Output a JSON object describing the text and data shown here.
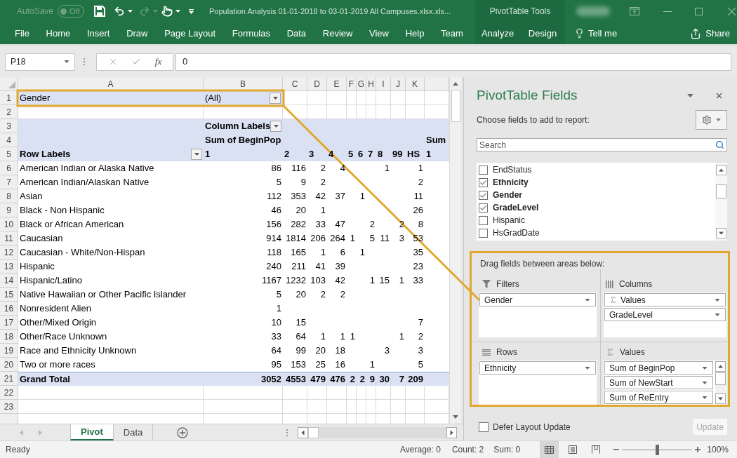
{
  "title_bar": {
    "autosave": {
      "label": "AutoSave",
      "toggle_label": "Off",
      "on": false
    },
    "redo_disabled": true,
    "document_title": "Population Analysis 01-01-2018 to 03-01-2019 All Campuses.xlsx.xls...",
    "context_group": "PivotTable Tools"
  },
  "ribbon": {
    "tabs": [
      {
        "label": "File",
        "contextual": false
      },
      {
        "label": "Home",
        "contextual": false
      },
      {
        "label": "Insert",
        "contextual": false
      },
      {
        "label": "Draw",
        "contextual": false
      },
      {
        "label": "Page Layout",
        "contextual": false
      },
      {
        "label": "Formulas",
        "contextual": false
      },
      {
        "label": "Data",
        "contextual": false
      },
      {
        "label": "Review",
        "contextual": false
      },
      {
        "label": "View",
        "contextual": false
      },
      {
        "label": "Help",
        "contextual": false
      },
      {
        "label": "Team",
        "contextual": false
      },
      {
        "label": "Analyze",
        "contextual": true
      },
      {
        "label": "Design",
        "contextual": true
      }
    ],
    "tell_me": "Tell me",
    "share": "Share"
  },
  "formula_bar": {
    "name_box": "P18",
    "function_button": "fx",
    "formula": "0"
  },
  "sheet": {
    "columns": [
      "A",
      "B",
      "C",
      "D",
      "E",
      "F",
      "G",
      "H",
      "I",
      "J",
      "K"
    ],
    "rows": [
      {
        "number": "1",
        "kind": "filter",
        "cells": [
          "Gender",
          {
            "text": "(All)",
            "filter_button": true
          }
        ]
      },
      {
        "number": "2",
        "kind": "blank"
      },
      {
        "number": "3",
        "kind": "header",
        "cells": [
          null,
          {
            "text": "Column Labels",
            "filter_button": true
          }
        ]
      },
      {
        "number": "4",
        "kind": "header",
        "cells": [
          null,
          "Sum of BeginPop",
          null,
          null,
          null,
          null,
          null,
          null,
          null,
          null,
          null,
          "Sum"
        ]
      },
      {
        "number": "5",
        "kind": "header",
        "cells": [
          {
            "text": "Row Labels",
            "filter_button": true
          },
          "1",
          "2",
          "3",
          "4",
          "5",
          "6",
          "7",
          "8",
          "99",
          "HS",
          "1"
        ]
      },
      {
        "number": "6",
        "kind": "data",
        "cells": [
          "American Indian or Alaska Native",
          "86",
          "116",
          "2",
          "4",
          null,
          null,
          null,
          "1",
          null,
          "1"
        ]
      },
      {
        "number": "7",
        "kind": "data",
        "cells": [
          "American Indian/Alaskan Native",
          "5",
          "9",
          "2",
          null,
          null,
          null,
          null,
          null,
          null,
          "2"
        ]
      },
      {
        "number": "8",
        "kind": "data",
        "cells": [
          "Asian",
          "112",
          "353",
          "42",
          "37",
          null,
          "1",
          null,
          null,
          null,
          "11"
        ]
      },
      {
        "number": "9",
        "kind": "data",
        "cells": [
          "Black - Non Hispanic",
          "46",
          "20",
          "1",
          null,
          null,
          null,
          null,
          null,
          null,
          "26"
        ]
      },
      {
        "number": "10",
        "kind": "data",
        "cells": [
          "Black or African American",
          "156",
          "282",
          "33",
          "47",
          null,
          null,
          "2",
          null,
          "2",
          "8"
        ]
      },
      {
        "number": "11",
        "kind": "data",
        "cells": [
          "Caucasian",
          "914",
          "1814",
          "206",
          "264",
          "1",
          null,
          "5",
          "11",
          "3",
          "53"
        ]
      },
      {
        "number": "12",
        "kind": "data",
        "cells": [
          "Caucasian - White/Non-Hispan",
          "118",
          "165",
          "1",
          "6",
          null,
          "1",
          null,
          null,
          null,
          "35"
        ]
      },
      {
        "number": "13",
        "kind": "data",
        "cells": [
          "Hispanic",
          "240",
          "211",
          "41",
          "39",
          null,
          null,
          null,
          null,
          null,
          "23"
        ]
      },
      {
        "number": "14",
        "kind": "data",
        "cells": [
          "Hispanic/Latino",
          "1167",
          "1232",
          "103",
          "42",
          null,
          null,
          "1",
          "15",
          "1",
          "33"
        ]
      },
      {
        "number": "15",
        "kind": "data",
        "cells": [
          "Native Hawaiian or Other Pacific Islander",
          "5",
          "20",
          "2",
          "2"
        ]
      },
      {
        "number": "16",
        "kind": "data",
        "cells": [
          "Nonresident Alien",
          "1"
        ]
      },
      {
        "number": "17",
        "kind": "data",
        "cells": [
          "Other/Mixed Origin",
          "10",
          "15",
          null,
          null,
          null,
          null,
          null,
          null,
          null,
          "7"
        ]
      },
      {
        "number": "18",
        "kind": "data",
        "cells": [
          "Other/Race Unknown",
          "33",
          "64",
          "1",
          "1",
          "1",
          null,
          null,
          null,
          "1",
          "2"
        ]
      },
      {
        "number": "19",
        "kind": "data",
        "cells": [
          "Race and Ethnicity Unknown",
          "64",
          "99",
          "20",
          "18",
          null,
          null,
          null,
          "3",
          null,
          "3"
        ]
      },
      {
        "number": "20",
        "kind": "data",
        "cells": [
          "Two or more races",
          "95",
          "153",
          "25",
          "16",
          null,
          null,
          "1",
          null,
          null,
          "5"
        ]
      },
      {
        "number": "21",
        "kind": "total",
        "cells": [
          "Grand Total",
          "3052",
          "4553",
          "479",
          "476",
          "2",
          "2",
          "9",
          "30",
          "7",
          "209"
        ]
      },
      {
        "number": "22",
        "kind": "empty"
      },
      {
        "number": "23",
        "kind": "empty"
      }
    ]
  },
  "sheet_tabs": [
    {
      "label": "Pivot",
      "selected": true
    },
    {
      "label": "Data",
      "selected": false
    }
  ],
  "pivot_fields": {
    "title": "PivotTable Fields",
    "subtitle": "Choose fields to add to report:",
    "search": {
      "placeholder": "Search"
    },
    "fields": [
      {
        "name": "EndStatus",
        "checked": false
      },
      {
        "name": "Ethnicity",
        "checked": true
      },
      {
        "name": "Gender",
        "checked": true
      },
      {
        "name": "GradeLevel",
        "checked": true
      },
      {
        "name": "Hispanic",
        "checked": false
      },
      {
        "name": "HsGradDate",
        "checked": false
      }
    ],
    "areas_hint": "Drag fields between areas below:",
    "areas": [
      {
        "kind": "filters",
        "title": "Filters",
        "items": [
          {
            "label": "Gender",
            "kind": "field"
          }
        ]
      },
      {
        "kind": "columns",
        "title": "Columns",
        "items": [
          {
            "label": "Values",
            "kind": "values"
          },
          {
            "label": "GradeLevel",
            "kind": "field"
          }
        ]
      },
      {
        "kind": "rows",
        "title": "Rows",
        "items": [
          {
            "label": "Ethnicity",
            "kind": "field"
          }
        ]
      },
      {
        "kind": "values",
        "title": "Values",
        "items": [
          {
            "label": "Sum of BeginPop",
            "kind": "field"
          },
          {
            "label": "Sum of NewStart",
            "kind": "field"
          },
          {
            "label": "Sum of ReEntry",
            "kind": "field"
          }
        ]
      }
    ],
    "defer_layout_update": {
      "label": "Defer Layout Update",
      "checked": false
    },
    "update_button": {
      "label": "Update",
      "disabled": true
    }
  },
  "status_bar": {
    "status": "Ready",
    "average": "Average: 0",
    "count": "Count: 2",
    "sum": "Sum: 0",
    "views": [
      {
        "kind": "normal",
        "selected": true
      },
      {
        "kind": "page_layout",
        "selected": false
      },
      {
        "kind": "page_break_preview",
        "selected": false
      }
    ],
    "zoom": {
      "level": 0.5,
      "label": "100%"
    }
  }
}
